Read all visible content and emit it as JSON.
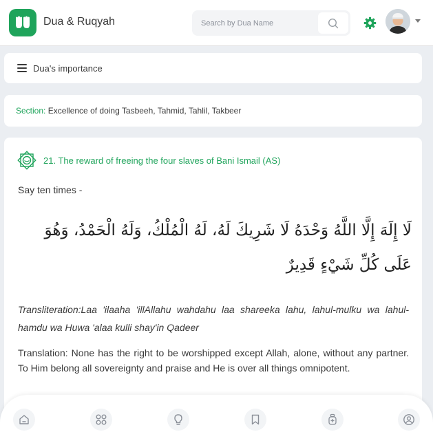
{
  "header": {
    "app_title": "Dua & Ruqyah",
    "search": {
      "placeholder": "Search by Dua Name",
      "value": ""
    },
    "icons": {
      "logo": "hands-icon",
      "search": "search-icon",
      "settings": "gear-icon",
      "avatar": "avatar",
      "menu": "chevron-down-icon"
    }
  },
  "importance_bar": {
    "label": "Dua's importance"
  },
  "section": {
    "key": "Section:",
    "value": "Excellence of doing Tasbeeh, Tahmid, Tahlil, Takbeer"
  },
  "dua": {
    "title": "21. The reward of freeing the four slaves of Bani Ismail (AS)",
    "instruction": "Say ten times -",
    "arabic": "لَا إِلَهَ إِلَّا اللَّهُ وَحْدَهُ لَا شَرِيكَ لَهُ، لَهُ الْمُلْكُ، وَلَهُ الْحَمْدُ، وَهُوَ عَلَى كُلِّ شَيْءٍ قَدِيرٌ",
    "transliteration": "Transliteration:Laa 'ilaaha 'illAllahu wahdahu laa shareeka lahu, lahul-mulku wa lahul-hamdu wa Huwa 'alaa kulli shay'in Qadeer",
    "translation": "Translation: None has the right to be worshipped except Allah, alone, without any partner. To Him belong all sovereignty and praise and He is over all things omnipotent."
  },
  "bottom_nav": {
    "items": [
      "home-icon",
      "grid-icon",
      "bulb-icon",
      "bookmark-icon",
      "ruqyah-icon",
      "profile-icon"
    ]
  },
  "colors": {
    "accent": "#1fa45b",
    "background": "#ebeef2",
    "card": "#ffffff",
    "text": "#393939"
  }
}
